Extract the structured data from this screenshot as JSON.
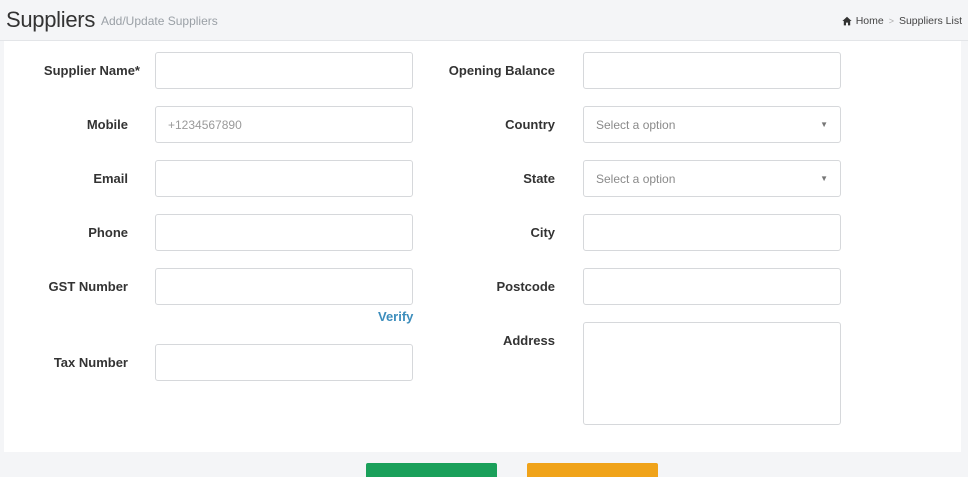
{
  "header": {
    "title": "Suppliers",
    "subtitle": "Add/Update Suppliers",
    "breadcrumb": {
      "home": "Home",
      "separator": ">",
      "current": "Suppliers List"
    }
  },
  "form": {
    "left": {
      "supplier_name": {
        "label": "Supplier Name*",
        "value": "",
        "placeholder": ""
      },
      "mobile": {
        "label": "Mobile",
        "value": "",
        "placeholder": "+1234567890"
      },
      "email": {
        "label": "Email",
        "value": "",
        "placeholder": ""
      },
      "phone": {
        "label": "Phone",
        "value": "",
        "placeholder": ""
      },
      "gst_number": {
        "label": "GST Number",
        "value": "",
        "placeholder": ""
      },
      "verify": {
        "label": "Verify"
      },
      "tax_number": {
        "label": "Tax Number",
        "value": "",
        "placeholder": ""
      }
    },
    "right": {
      "opening_balance": {
        "label": "Opening Balance",
        "value": "",
        "placeholder": ""
      },
      "country": {
        "label": "Country",
        "selected": "Select a option"
      },
      "state": {
        "label": "State",
        "selected": "Select a option"
      },
      "city": {
        "label": "City",
        "value": "",
        "placeholder": ""
      },
      "postcode": {
        "label": "Postcode",
        "value": "",
        "placeholder": ""
      },
      "address": {
        "label": "Address",
        "value": "",
        "placeholder": ""
      }
    }
  },
  "buttons": {
    "save_color": "#1aa05a",
    "reset_color": "#f0a31a"
  },
  "icons": {
    "home": "home-icon",
    "dropdown": "caret-down-icon"
  }
}
